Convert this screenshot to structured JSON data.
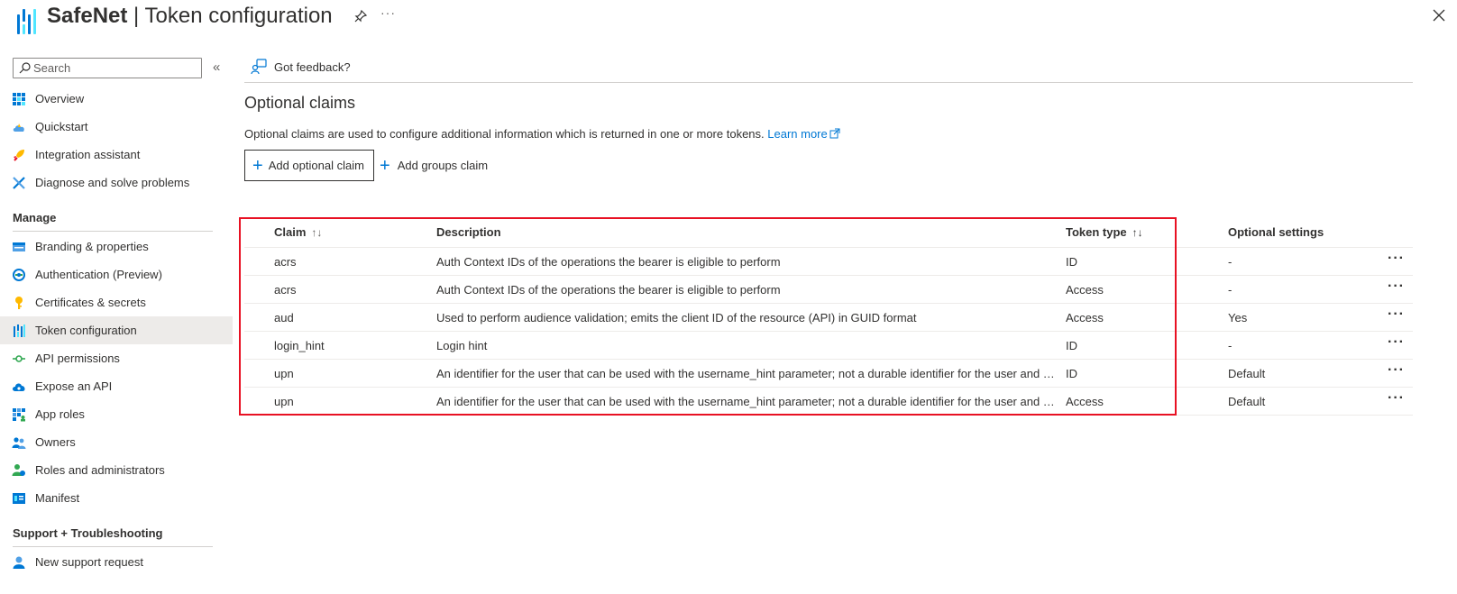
{
  "header": {
    "app_name": "SafeNet",
    "separator": " | ",
    "blade_title": "Token configuration",
    "more": "···"
  },
  "sidebar": {
    "search_placeholder": "Search",
    "collapse": "«",
    "items_top": [
      {
        "label": "Overview",
        "icon": "overview-grid-icon"
      },
      {
        "label": "Quickstart",
        "icon": "quickstart-cloud-icon"
      },
      {
        "label": "Integration assistant",
        "icon": "rocket-icon"
      },
      {
        "label": "Diagnose and solve problems",
        "icon": "wrench-cross-icon"
      }
    ],
    "manage_title": "Manage",
    "items_manage": [
      {
        "label": "Branding & properties",
        "icon": "branding-icon"
      },
      {
        "label": "Authentication (Preview)",
        "icon": "authentication-icon"
      },
      {
        "label": "Certificates & secrets",
        "icon": "key-icon"
      },
      {
        "label": "Token configuration",
        "icon": "token-config-icon"
      },
      {
        "label": "API permissions",
        "icon": "api-permissions-icon"
      },
      {
        "label": "Expose an API",
        "icon": "expose-api-cloud-icon"
      },
      {
        "label": "App roles",
        "icon": "app-roles-icon"
      },
      {
        "label": "Owners",
        "icon": "owners-icon"
      },
      {
        "label": "Roles and administrators",
        "icon": "roles-admin-icon"
      },
      {
        "label": "Manifest",
        "icon": "manifest-icon"
      }
    ],
    "support_title": "Support + Troubleshooting",
    "items_support": [
      {
        "label": "New support request",
        "icon": "support-person-icon"
      }
    ],
    "active_item": "Token configuration"
  },
  "toolbar": {
    "feedback_label": "Got feedback?"
  },
  "main": {
    "title": "Optional claims",
    "description": "Optional claims are used to configure additional information which is returned in one or more tokens. ",
    "learn_more": "Learn more",
    "add_optional_claim": "Add optional claim",
    "add_groups_claim": "Add groups claim"
  },
  "table": {
    "columns": {
      "claim": "Claim",
      "description": "Description",
      "token_type": "Token type",
      "optional_settings": "Optional settings"
    },
    "sort_glyph": "↑↓",
    "row_more": "···",
    "rows": [
      {
        "claim": "acrs",
        "description": "Auth Context IDs of the operations the bearer is eligible to perform",
        "token_type": "ID",
        "optional_settings": "-"
      },
      {
        "claim": "acrs",
        "description": "Auth Context IDs of the operations the bearer is eligible to perform",
        "token_type": "Access",
        "optional_settings": "-"
      },
      {
        "claim": "aud",
        "description": "Used to perform audience validation; emits the client ID of the resource (API) in GUID format",
        "token_type": "Access",
        "optional_settings": "Yes"
      },
      {
        "claim": "login_hint",
        "description": "Login hint",
        "token_type": "ID",
        "optional_settings": "-"
      },
      {
        "claim": "upn",
        "description": "An identifier for the user that can be used with the username_hint parameter; not a durable identifier for the user and sho…",
        "token_type": "ID",
        "optional_settings": "Default"
      },
      {
        "claim": "upn",
        "description": "An identifier for the user that can be used with the username_hint parameter; not a durable identifier for the user and sho…",
        "token_type": "Access",
        "optional_settings": "Default"
      }
    ]
  },
  "colors": {
    "accent": "#0078d4",
    "highlight_border": "#e81123",
    "active_nav_bg": "#edebe9"
  }
}
